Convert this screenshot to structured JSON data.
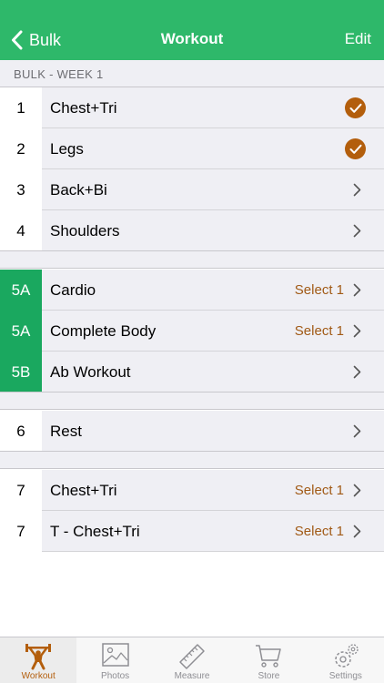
{
  "nav": {
    "back_label": "Bulk",
    "title": "Workout",
    "edit_label": "Edit"
  },
  "section_title": "BULK - WEEK 1",
  "rows": [
    {
      "day": "1",
      "name": "Chest+Tri",
      "status": "completed"
    },
    {
      "day": "2",
      "name": "Legs",
      "status": "completed"
    },
    {
      "day": "3",
      "name": "Back+Bi",
      "status": "chevron"
    },
    {
      "day": "4",
      "name": "Shoulders",
      "status": "chevron"
    },
    {
      "day": "5A",
      "name": "Cardio",
      "select": "Select 1"
    },
    {
      "day": "5A",
      "name": "Complete Body",
      "select": "Select 1"
    },
    {
      "day": "5B",
      "name": "Ab Workout",
      "status": "chevron"
    },
    {
      "day": "6",
      "name": "Rest",
      "status": "chevron"
    },
    {
      "day": "7",
      "name": "Chest+Tri",
      "select": "Select 1"
    },
    {
      "day": "7",
      "name": "T - Chest+Tri",
      "select": "Select 1"
    }
  ],
  "tabs": [
    {
      "label": "Workout",
      "icon": "weightlifter-icon",
      "active": true
    },
    {
      "label": "Photos",
      "icon": "photo-icon"
    },
    {
      "label": "Measure",
      "icon": "ruler-icon"
    },
    {
      "label": "Store",
      "icon": "cart-icon"
    },
    {
      "label": "Settings",
      "icon": "gear-icon"
    }
  ],
  "colors": {
    "nav_green": "#2eb86a",
    "day_green": "#1aa85f",
    "accent_orange": "#b35e0c",
    "select_text": "#a15a16"
  }
}
